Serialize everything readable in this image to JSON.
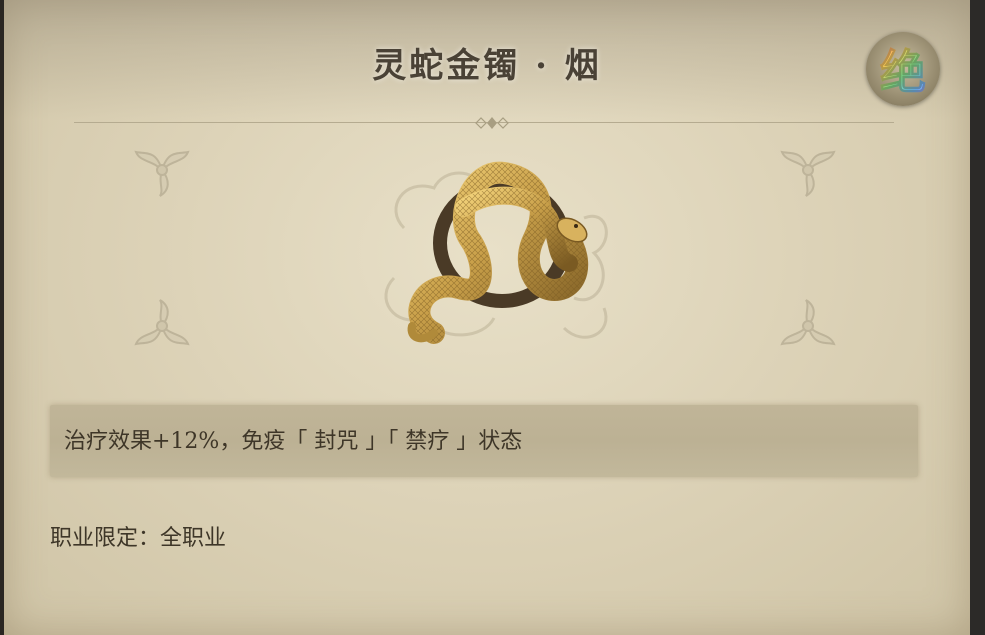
{
  "item": {
    "title": "灵蛇金镯 · 烟",
    "rarity_label": "绝",
    "rarity_gradient_colors": [
      "#ff6a8a",
      "#ffd15a",
      "#7ee08a",
      "#6ab8ff",
      "#c88aff"
    ]
  },
  "effect": {
    "text": "治疗效果+12%，免疫「 封咒 」「 禁疗 」状态"
  },
  "requirement": {
    "label": "职业限定：",
    "value": "全职业"
  },
  "icons": {
    "item": "golden-snake-bracelet",
    "corner": "fleur-ornament",
    "divider": "diamond-ornament",
    "badge": "rarity-badge"
  },
  "colors": {
    "parchment": "#ddd3b8",
    "text": "#3e3628",
    "title": "#4a4236",
    "gold": "#c9a04a"
  }
}
